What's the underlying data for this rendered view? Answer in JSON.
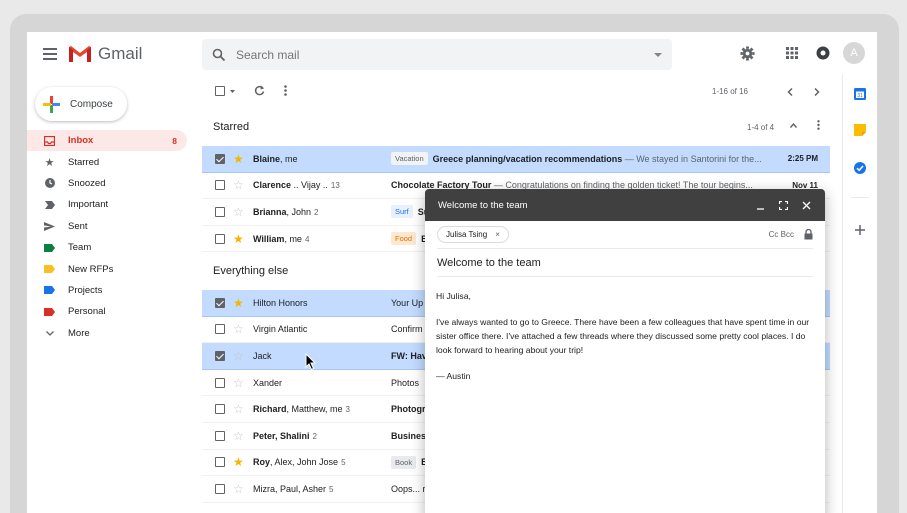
{
  "header": {
    "app_name": "Gmail",
    "search_placeholder": "Search mail",
    "avatar_letter": "A"
  },
  "sidebar": {
    "compose_label": "Compose",
    "items": [
      {
        "label": "Inbox",
        "count": "8",
        "icon": "inbox-icon",
        "color": "#d93025"
      },
      {
        "label": "Starred",
        "icon": "star-icon",
        "color": "#5f6368"
      },
      {
        "label": "Snoozed",
        "icon": "clock-icon",
        "color": "#5f6368"
      },
      {
        "label": "Important",
        "icon": "important-icon",
        "color": "#5f6368"
      },
      {
        "label": "Sent",
        "icon": "send-icon",
        "color": "#5f6368"
      },
      {
        "label": "Team",
        "icon": "label-icon",
        "color": "#0b8043"
      },
      {
        "label": "New RFPs",
        "icon": "label-icon",
        "color": "#f6bf26"
      },
      {
        "label": "Projects",
        "icon": "label-icon",
        "color": "#1a73e8"
      },
      {
        "label": "Personal",
        "icon": "label-icon",
        "color": "#d93025"
      },
      {
        "label": "More",
        "icon": "chevron-down-icon",
        "color": "#5f6368"
      }
    ]
  },
  "toolbar": {
    "pager": "1-16 of 16"
  },
  "starred": {
    "title": "Starred",
    "count": "1-4 of 4",
    "rows": [
      {
        "selected": true,
        "starred": true,
        "sender": "Blaine",
        "sender_rest": ", me",
        "count": "",
        "tag": "Vacation",
        "subject": "Greece planning/vacation recommendations",
        "snippet": " — We stayed in Santorini for the...",
        "date": "2:25 PM"
      },
      {
        "selected": false,
        "starred": false,
        "sender": "Clarence",
        "sender_rest": " .. Vijay ..",
        "count": "13",
        "tag": "",
        "subject": "Chocolate Factory Tour",
        "snippet": " — Congratulations on finding the golden ticket! The tour begins...",
        "date": "Nov 11"
      },
      {
        "selected": false,
        "starred": false,
        "sender": "Brianna",
        "sender_rest": ", John",
        "count": "2",
        "tag": "Surf",
        "subject": "Surf",
        "snippet": "",
        "date": ""
      },
      {
        "selected": false,
        "starred": true,
        "sender": "William",
        "sender_rest": ", me",
        "count": "4",
        "tag": "Food",
        "subject": "B",
        "snippet": "",
        "date": ""
      }
    ]
  },
  "everything": {
    "title": "Everything else",
    "rows": [
      {
        "selected": true,
        "starred": true,
        "sender": "Hilton Honors",
        "bold": false,
        "count": "",
        "tag": "",
        "subject": "Your Up",
        "bold_subject": false
      },
      {
        "selected": false,
        "starred": false,
        "sender": "Virgin Atlantic",
        "bold": false,
        "count": "",
        "tag": "",
        "subject": "Confirm",
        "bold_subject": false
      },
      {
        "selected": true,
        "starred": false,
        "sender": "Jack",
        "bold": false,
        "count": "",
        "tag": "",
        "subject": "FW: Hav",
        "bold_subject": true
      },
      {
        "selected": false,
        "starred": false,
        "sender": "Xander",
        "bold": false,
        "count": "",
        "tag": "",
        "subject": "Photos",
        "bold_subject": false
      },
      {
        "selected": false,
        "starred": false,
        "sender": "Richard",
        "sender_rest": ", Matthew, me",
        "bold": true,
        "count": "3",
        "tag": "",
        "subject": "Photogr",
        "bold_subject": true
      },
      {
        "selected": false,
        "starred": false,
        "sender": "Peter, Shalini",
        "bold": true,
        "count": "2",
        "tag": "",
        "subject": "Busines",
        "bold_subject": true
      },
      {
        "selected": false,
        "starred": true,
        "sender": "Roy",
        "sender_rest": ", Alex, John Jose",
        "bold": true,
        "count": "5",
        "tag": "Book",
        "subject": "B",
        "bold_subject": true
      },
      {
        "selected": false,
        "starred": false,
        "sender": "Mizra, Paul, Asher",
        "bold": false,
        "count": "5",
        "tag": "",
        "subject": "Oops... r",
        "bold_subject": false
      }
    ]
  },
  "compose_window": {
    "title": "Welcome to the team",
    "recipient": "Julisa Tsing",
    "cc_bcc": "Cc Bcc",
    "subject": "Welcome to the team",
    "greeting": "Hi Julisa,",
    "body": "I've always wanted to go to Greece. There have been a few colleagues that have spent time in our sister office there. I've attached a few threads where they discussed some pretty cool places. I do look forward to hearing about your trip!",
    "signature": "— Austin"
  }
}
